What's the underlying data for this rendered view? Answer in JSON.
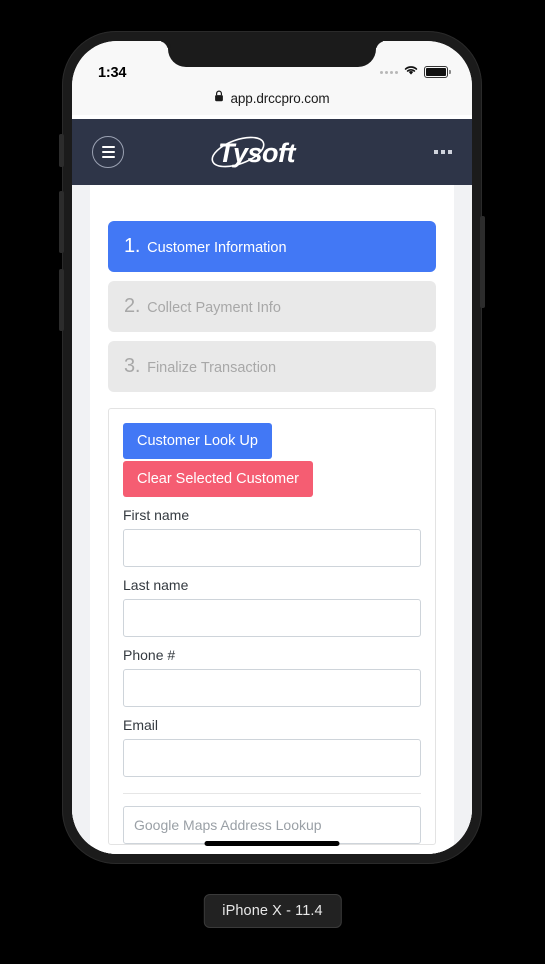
{
  "device": {
    "caption": "iPhone X - 11.4",
    "statusbar": {
      "time": "1:34",
      "signal_icon": "signal-dots-icon",
      "wifi_icon": "wifi-icon",
      "battery_icon": "battery-full-icon"
    }
  },
  "browser": {
    "lock_icon": "lock-icon",
    "url": "app.drccpro.com"
  },
  "navbar": {
    "menu_icon": "hamburger-menu-icon",
    "brand": "Tysoft",
    "brand_logo_icon": "tysoft-orbit-logo-icon",
    "overflow_icon": "more-options-icon"
  },
  "steps": [
    {
      "number": "1.",
      "label": "Customer Information",
      "state": "active"
    },
    {
      "number": "2.",
      "label": "Collect Payment Info",
      "state": "inactive"
    },
    {
      "number": "3.",
      "label": "Finalize Transaction",
      "state": "inactive"
    }
  ],
  "form": {
    "buttons": {
      "lookup": "Customer Look Up",
      "clear": "Clear Selected Customer"
    },
    "fields": [
      {
        "label": "First name",
        "value": "",
        "placeholder": ""
      },
      {
        "label": "Last name",
        "value": "",
        "placeholder": ""
      },
      {
        "label": "Phone #",
        "value": "",
        "placeholder": ""
      },
      {
        "label": "Email",
        "value": "",
        "placeholder": ""
      }
    ],
    "address_lookup": {
      "placeholder": "Google Maps Address Lookup",
      "value": ""
    }
  },
  "colors": {
    "accent_blue": "#4278f5",
    "danger_red": "#f55d72",
    "navbar_dark": "#2e3548",
    "step_inactive": "#e9e9e9",
    "page_bg": "#f1f2f4"
  }
}
